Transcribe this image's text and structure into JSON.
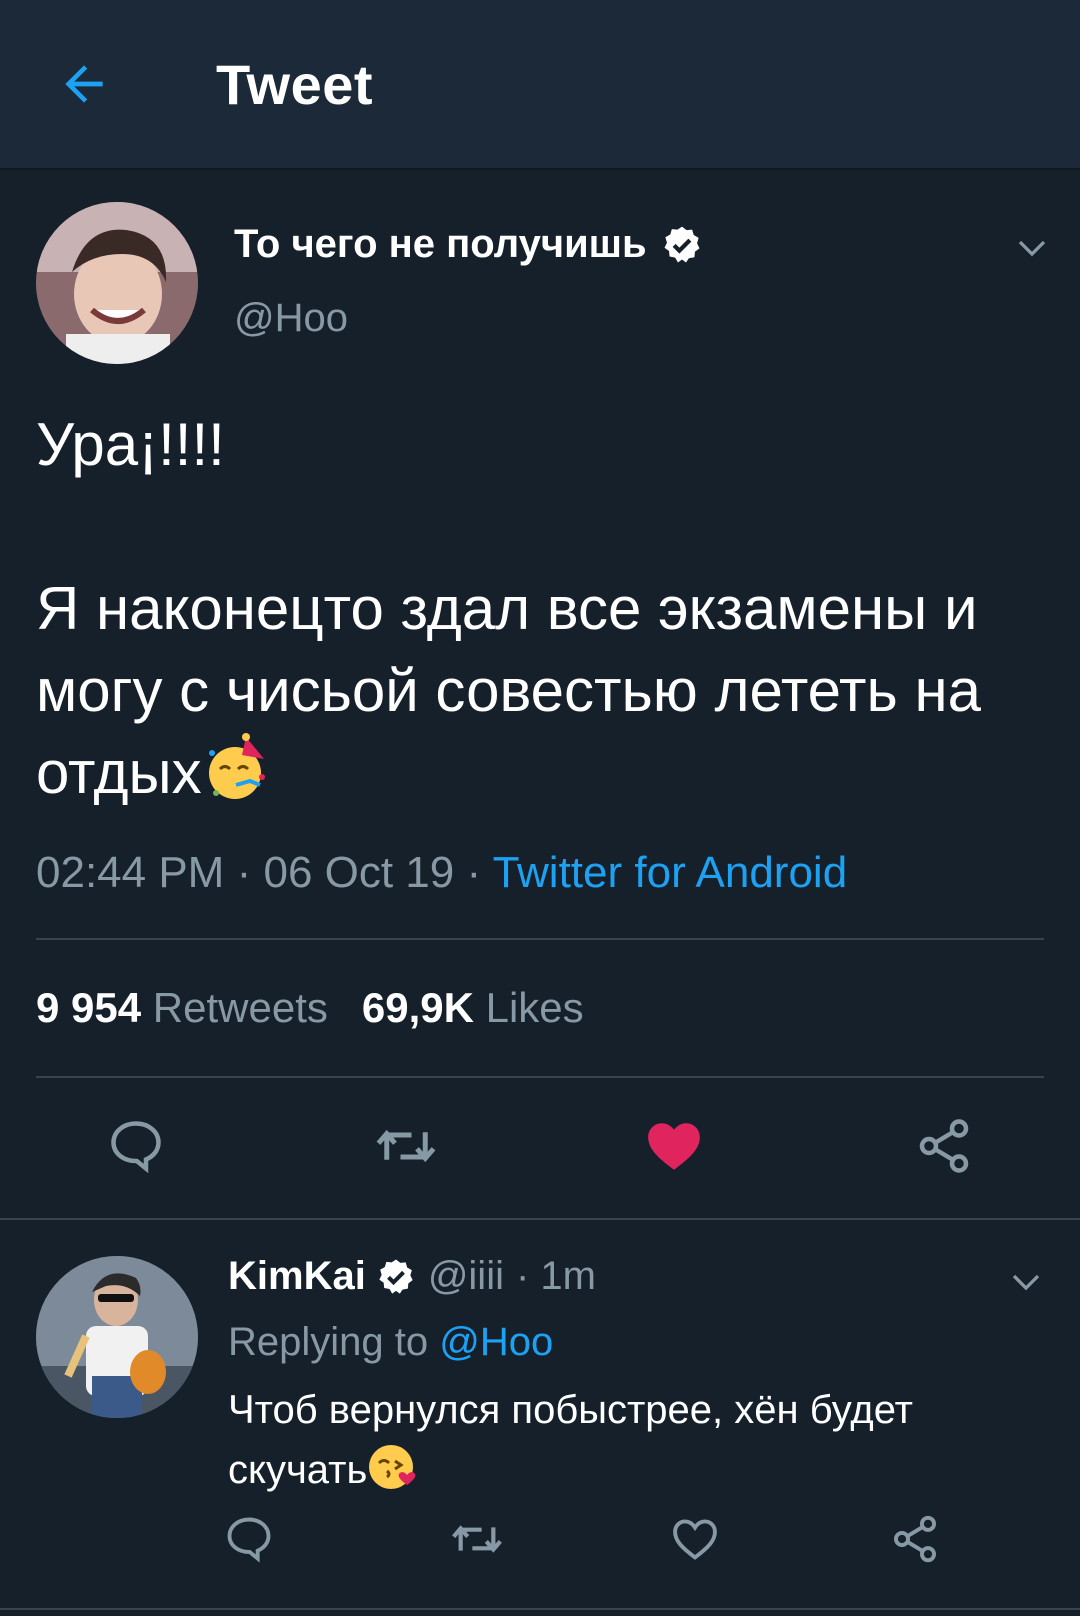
{
  "header": {
    "title": "Tweet"
  },
  "tweet": {
    "author_name": "То чего не получишь",
    "handle": "@Hoo",
    "text_line1": "Ура¡!!!!",
    "text_body": "Я наконецто здал все экзамены и могу с чисьой совестью лететь на отдых",
    "emoji": "partying-face",
    "time": "02:44 PM",
    "sep": "·",
    "date": "06 Oct 19",
    "source": "Twitter for Android",
    "retweets_count": "9 954",
    "retweets_label": "Retweets",
    "likes_count": "69,9K",
    "likes_label": "Likes",
    "liked": true
  },
  "reply": {
    "author_name": "KimKai",
    "handle": "@iiii",
    "time": "· 1m",
    "replying_prefix": "Replying to",
    "replying_to": "@Hoo",
    "text": "Чтоб вернулся побыстрее, хён будет скучать",
    "emoji": "face-blowing-a-kiss"
  },
  "colors": {
    "background": "#15202b",
    "header": "#1c2938",
    "accent": "#1da1f2",
    "muted": "#8899a6",
    "like": "#e0245e",
    "divider": "#38444d"
  }
}
